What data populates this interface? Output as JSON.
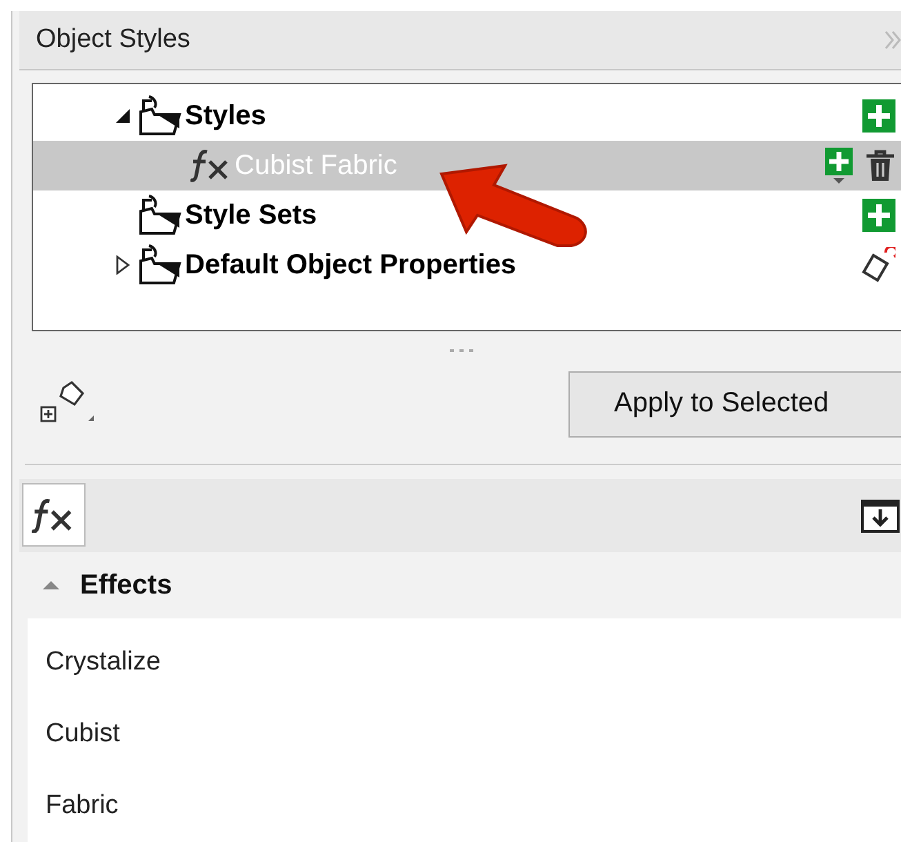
{
  "panel": {
    "title": "Object Styles"
  },
  "tree": [
    {
      "label": "Styles",
      "kind": "group",
      "expanded": true,
      "selected": false,
      "can_add": true,
      "children": [
        {
          "label": "Cubist Fabric",
          "kind": "style",
          "selected": true,
          "can_add": true,
          "can_delete": true
        }
      ]
    },
    {
      "label": "Style Sets",
      "kind": "group",
      "selected": false,
      "can_add": true
    },
    {
      "label": "Default Object Properties",
      "kind": "group",
      "expanded": false,
      "selected": false,
      "can_reset": true
    }
  ],
  "apply_button": "Apply to Selected",
  "section": {
    "title": "Effects",
    "expanded": true,
    "items": [
      "Crystalize",
      "Cubist",
      "Fabric"
    ]
  }
}
